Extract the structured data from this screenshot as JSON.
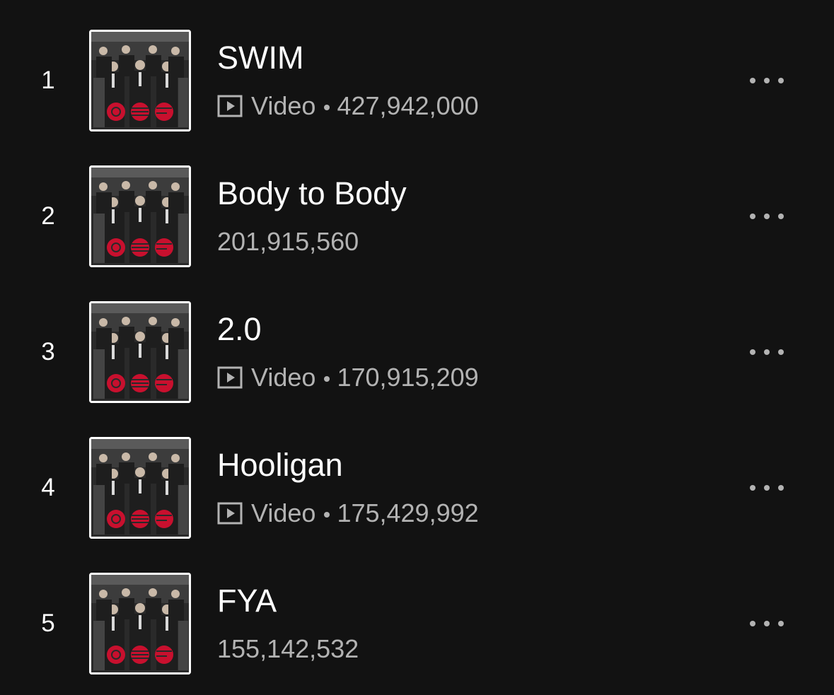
{
  "tracks": [
    {
      "rank": "1",
      "title": "SWIM",
      "is_video": true,
      "type_label": "Video",
      "plays": "427,942,000"
    },
    {
      "rank": "2",
      "title": "Body to Body",
      "is_video": false,
      "type_label": "",
      "plays": "201,915,560"
    },
    {
      "rank": "3",
      "title": "2.0",
      "is_video": true,
      "type_label": "Video",
      "plays": "170,915,209"
    },
    {
      "rank": "4",
      "title": "Hooligan",
      "is_video": true,
      "type_label": "Video",
      "plays": "175,429,992"
    },
    {
      "rank": "5",
      "title": "FYA",
      "is_video": false,
      "type_label": "",
      "plays": "155,142,532"
    }
  ],
  "icons": {
    "video": "video-icon",
    "more": "more-options-icon"
  },
  "colors": {
    "background": "#121212",
    "primary_text": "#ffffff",
    "secondary_text": "#b3b3b3",
    "logo_red": "#c8102e"
  }
}
